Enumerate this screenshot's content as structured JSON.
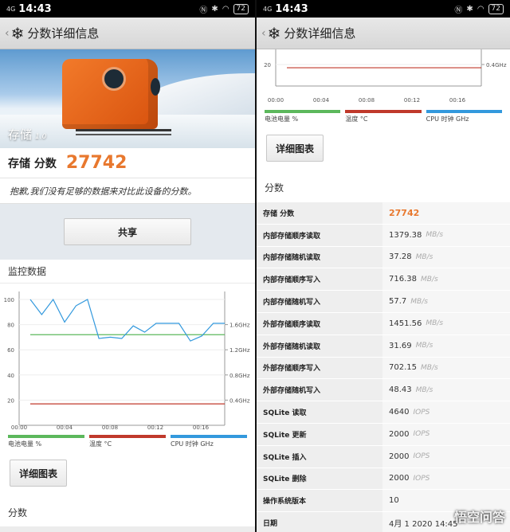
{
  "status": {
    "signal": "4G",
    "time": "14:43",
    "battery": "72"
  },
  "header": {
    "title": "分数详细信息"
  },
  "left": {
    "hero": {
      "label": "存储",
      "version": "1.0"
    },
    "score": {
      "label": "存储 分数",
      "value": "27742"
    },
    "note": "抱歉,我们没有足够的数据来对比此设备的分数。",
    "share_label": "共享",
    "monitor_title": "监控数据",
    "detail_btn": "详细图表",
    "score_section": "分数"
  },
  "chart_data": {
    "type": "line",
    "title": "",
    "x": [
      "00:00",
      "00:04",
      "00:08",
      "00:12",
      "00:16"
    ],
    "ylim": [
      0,
      100
    ],
    "yticks_left": [
      "100",
      "80",
      "60",
      "40",
      "20"
    ],
    "yticks_right": [
      "1.6GHz",
      "1.2GHz",
      "0.8GHz",
      "0.4GHz"
    ],
    "grid": true,
    "series": [
      {
        "name": "电池电量 %",
        "color": "#5cb85c",
        "values": [
          72,
          72,
          72,
          72,
          72,
          72,
          72,
          72,
          72,
          72,
          72,
          72,
          72,
          72,
          72,
          72,
          72,
          72
        ]
      },
      {
        "name": "温度 °C",
        "color": "#c0392b",
        "values": [
          17,
          17,
          17,
          17,
          17,
          17,
          17,
          17,
          17,
          17,
          17,
          17,
          17,
          17,
          17,
          17,
          17,
          17
        ]
      },
      {
        "name": "CPU 时钟 GHz",
        "color": "#3399dd",
        "values": [
          100,
          88,
          100,
          82,
          95,
          100,
          69,
          70,
          69,
          79,
          74,
          81,
          81,
          81,
          67,
          71,
          81,
          81
        ]
      }
    ]
  },
  "right": {
    "detail_btn": "详细图表",
    "score_section": "分数",
    "rows": [
      {
        "key": "存储 分数",
        "value": "27742",
        "unit": "",
        "highlight": true
      },
      {
        "key": "内部存储顺序读取",
        "value": "1379.38",
        "unit": "MB/s"
      },
      {
        "key": "内部存储随机读取",
        "value": "37.28",
        "unit": "MB/s"
      },
      {
        "key": "内部存储顺序写入",
        "value": "716.38",
        "unit": "MB/s"
      },
      {
        "key": "内部存储随机写入",
        "value": "57.7",
        "unit": "MB/s"
      },
      {
        "key": "外部存储顺序读取",
        "value": "1451.56",
        "unit": "MB/s"
      },
      {
        "key": "外部存储随机读取",
        "value": "31.69",
        "unit": "MB/s"
      },
      {
        "key": "外部存储顺序写入",
        "value": "702.15",
        "unit": "MB/s"
      },
      {
        "key": "外部存储随机写入",
        "value": "48.43",
        "unit": "MB/s"
      },
      {
        "key": "SQLite 读取",
        "value": "4640",
        "unit": "IOPS"
      },
      {
        "key": "SQLite 更新",
        "value": "2000",
        "unit": "IOPS"
      },
      {
        "key": "SQLite 插入",
        "value": "2000",
        "unit": "IOPS"
      },
      {
        "key": "SQLite 删除",
        "value": "2000",
        "unit": "IOPS"
      },
      {
        "key": "操作系统版本",
        "value": "10",
        "unit": ""
      },
      {
        "key": "日期",
        "value": "4月 1 2020 14:45",
        "unit": ""
      }
    ]
  },
  "watermark": "悟空问答"
}
